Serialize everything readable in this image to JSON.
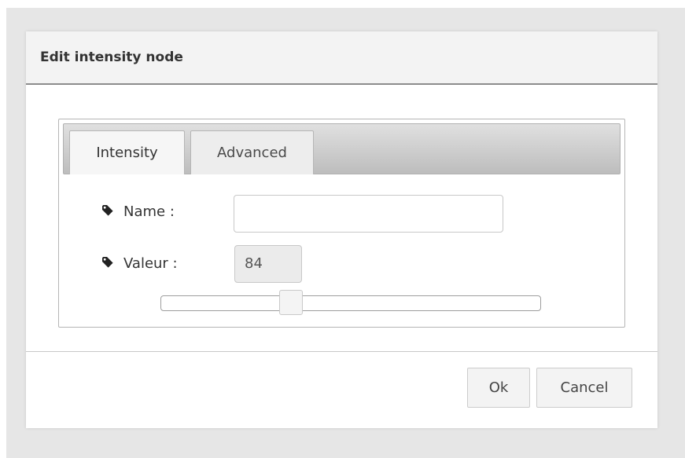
{
  "dialog": {
    "title": "Edit intensity node"
  },
  "tabs": [
    {
      "label": "Intensity",
      "active": true
    },
    {
      "label": "Advanced",
      "active": false
    }
  ],
  "fields": {
    "name": {
      "label": "Name :",
      "value": "",
      "icon": "tag-icon"
    },
    "valeur": {
      "label": "Valeur :",
      "value": "84",
      "icon": "tag-icon"
    }
  },
  "slider": {
    "value": 84
  },
  "buttons": {
    "ok": "Ok",
    "cancel": "Cancel"
  },
  "colors": {
    "backdrop": "#e6e6e6",
    "header_background": "#f3f3f3",
    "header_border": "#8c8c8c"
  }
}
